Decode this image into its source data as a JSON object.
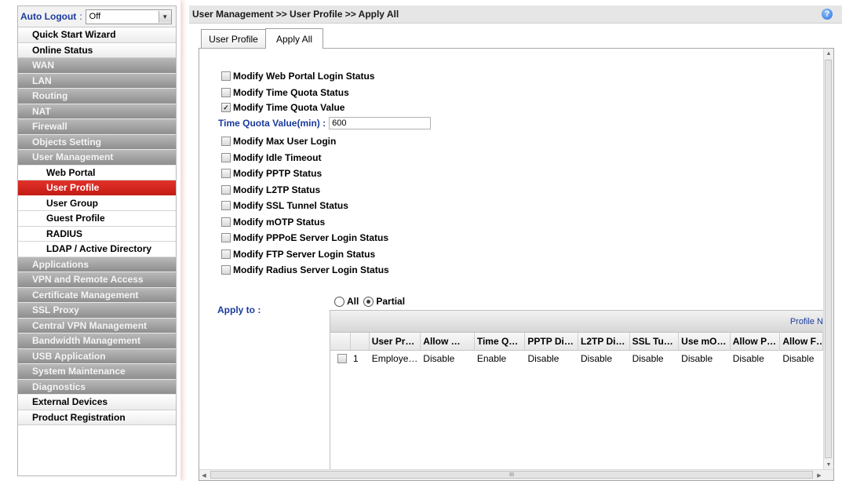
{
  "sidebar": {
    "auto_logout_label": "Auto Logout",
    "auto_logout_colon": ":",
    "auto_logout_value": "Off",
    "items": [
      {
        "label": "Quick Start Wizard",
        "style": "white"
      },
      {
        "label": "Online Status",
        "style": "white"
      },
      {
        "label": "WAN",
        "style": "gray"
      },
      {
        "label": "LAN",
        "style": "gray"
      },
      {
        "label": "Routing",
        "style": "gray"
      },
      {
        "label": "NAT",
        "style": "gray"
      },
      {
        "label": "Firewall",
        "style": "gray"
      },
      {
        "label": "Objects Setting",
        "style": "gray"
      },
      {
        "label": "User Management",
        "style": "gray"
      },
      {
        "label": "Web Portal",
        "style": "sub"
      },
      {
        "label": "User Profile",
        "style": "active"
      },
      {
        "label": "User Group",
        "style": "sub"
      },
      {
        "label": "Guest Profile",
        "style": "sub"
      },
      {
        "label": "RADIUS",
        "style": "sub"
      },
      {
        "label": "LDAP / Active Directory",
        "style": "sub"
      },
      {
        "label": "Applications",
        "style": "gray"
      },
      {
        "label": "VPN and Remote Access",
        "style": "gray"
      },
      {
        "label": "Certificate Management",
        "style": "gray"
      },
      {
        "label": "SSL Proxy",
        "style": "gray"
      },
      {
        "label": "Central VPN Management",
        "style": "gray"
      },
      {
        "label": "Bandwidth Management",
        "style": "gray"
      },
      {
        "label": "USB Application",
        "style": "gray"
      },
      {
        "label": "System Maintenance",
        "style": "gray"
      },
      {
        "label": "Diagnostics",
        "style": "gray"
      },
      {
        "label": "External Devices",
        "style": "white"
      },
      {
        "label": "Product Registration",
        "style": "white"
      }
    ]
  },
  "header": {
    "breadcrumb": "User Management >> User Profile >> Apply All",
    "help_icon": "?"
  },
  "tabs": [
    {
      "label": "User Profile",
      "active": false
    },
    {
      "label": "Apply All",
      "active": true
    }
  ],
  "options": [
    {
      "label": "Modify Web Portal Login Status",
      "checked": false
    },
    {
      "label": "Modify Time Quota Status",
      "checked": false
    },
    {
      "label": "Modify Time Quota Value",
      "checked": true
    },
    {
      "label": "Modify Max User Login",
      "checked": false
    },
    {
      "label": "Modify Idle Timeout",
      "checked": false
    },
    {
      "label": "Modify PPTP Status",
      "checked": false
    },
    {
      "label": "Modify L2TP Status",
      "checked": false
    },
    {
      "label": "Modify SSL Tunnel Status",
      "checked": false
    },
    {
      "label": "Modify mOTP Status",
      "checked": false
    },
    {
      "label": "Modify PPPoE Server Login Status",
      "checked": false
    },
    {
      "label": "Modify FTP Server Login Status",
      "checked": false
    },
    {
      "label": "Modify Radius Server Login Status",
      "checked": false
    }
  ],
  "time_quota": {
    "label": "Time Quota Value(min) :",
    "value": "600"
  },
  "apply_to": {
    "label": "Apply to :",
    "options": [
      {
        "label": "All",
        "selected": false
      },
      {
        "label": "Partial",
        "selected": true
      }
    ]
  },
  "grid": {
    "group_header": "Profile N",
    "columns": [
      "",
      "",
      "User Pr…",
      "Allow …",
      "Time Q…",
      "PPTP Di…",
      "L2TP Di…",
      "SSL Tu…",
      "Use mO…",
      "Allow P…",
      "Allow F…"
    ],
    "rows": [
      [
        "",
        "1",
        "Employe…",
        "Disable",
        "Enable",
        "Disable",
        "Disable",
        "Disable",
        "Disable",
        "Disable",
        "Disable"
      ]
    ]
  },
  "scrollbar_grip": "III"
}
